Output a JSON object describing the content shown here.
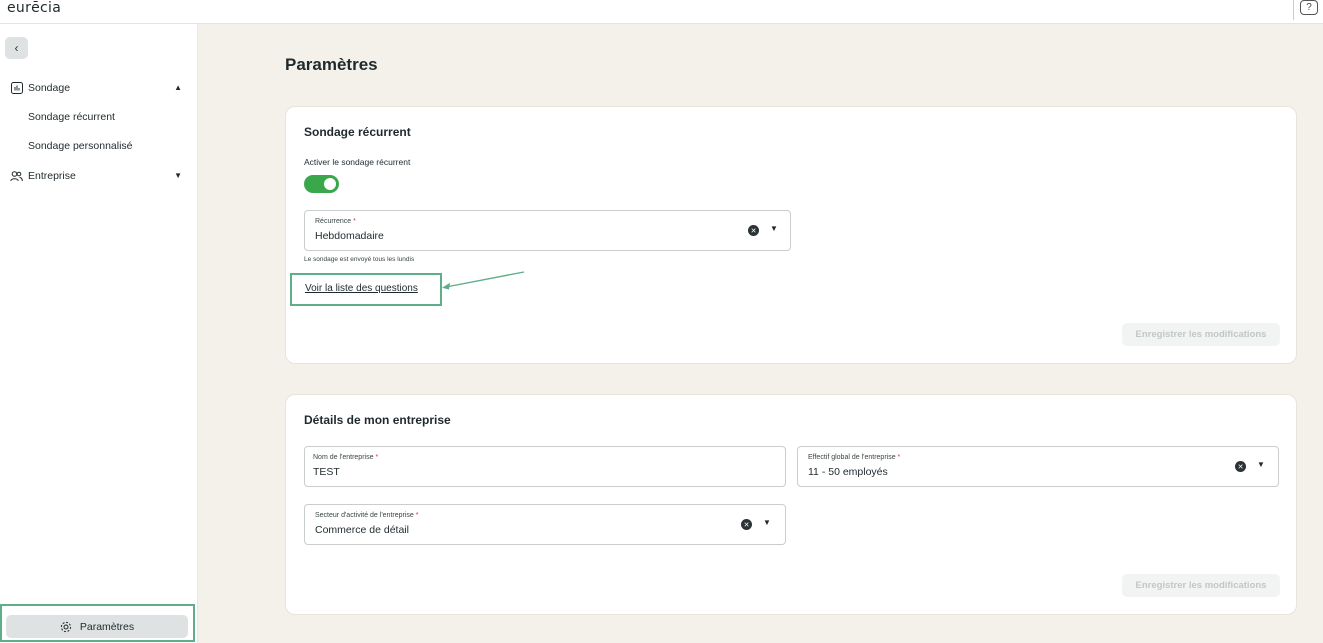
{
  "app": {
    "logo_text": "eurēcia"
  },
  "header": {
    "help_icon": "question-icon"
  },
  "sidebar": {
    "collapse_icon": "chevron-left-icon",
    "items": [
      {
        "label": "Sondage",
        "icon": "chart-icon",
        "expanded": true
      },
      {
        "label": "Sondage récurrent"
      },
      {
        "label": "Sondage personnalisé"
      },
      {
        "label": "Entreprise",
        "icon": "users-icon",
        "expanded": false
      }
    ],
    "settings_label": "Paramètres"
  },
  "main": {
    "title": "Paramètres",
    "recurring_card": {
      "title": "Sondage récurrent",
      "toggle_label": "Activer le sondage récurrent",
      "toggle_on": true,
      "recurrence_label": "Récurrence",
      "recurrence_value": "Hebdomadaire",
      "helper": "Le sondage est envoyé tous les lundis",
      "link": "Voir la liste des questions",
      "save_label": "Enregistrer les modifications"
    },
    "company_card": {
      "title": "Détails de mon entreprise",
      "name_label": "Nom de l'entreprise",
      "name_value": "TEST",
      "size_label": "Effectif global de l'entreprise",
      "size_value": "11 - 50 employés",
      "sector_label": "Secteur d'activité de l'entreprise",
      "sector_value": "Commerce de détail",
      "save_label": "Enregistrer les modifications"
    }
  },
  "colors": {
    "accent": "#3aa84a",
    "highlight": "#5fae8a",
    "background": "#f4f1ea"
  }
}
